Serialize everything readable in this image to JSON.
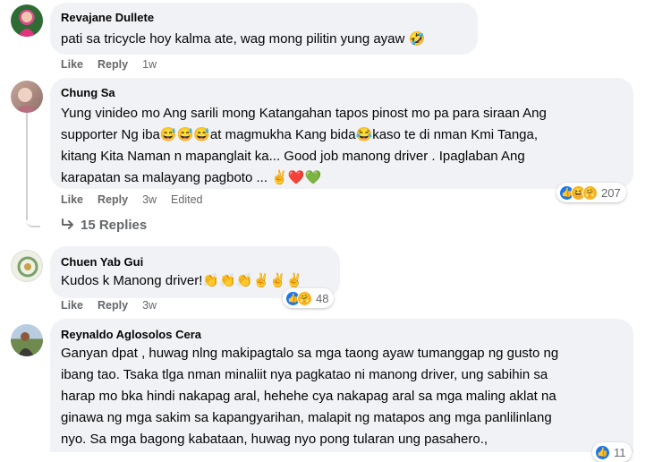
{
  "comments": [
    {
      "author": "Revajane Dullete",
      "text": "pati sa tricycle hoy kalma ate, wag mong pilitin yung ayaw 🤣",
      "like": "Like",
      "reply": "Reply",
      "time": "1w"
    },
    {
      "author": "Chung Sa",
      "line1": "Yung vinideo mo Ang sarili mong Katangahan tapos pinost mo pa para siraan Ang",
      "line2": "supporter Ng iba😅😅😅at magmukha Kang bida😂kaso te di nman Kmi Tanga,",
      "line3": "kitang Kita Naman n mapanglait ka... Good job manong driver . Ipaglaban Ang",
      "line4": "karapatan sa malayang pagboto ... ✌❤️💚",
      "like": "Like",
      "reply": "Reply",
      "time": "3w",
      "edited": "Edited",
      "reaction_count": "207",
      "replies_label": "15 Replies"
    },
    {
      "author": "Chuen Yab Gui",
      "text": "Kudos k Manong driver!👏👏👏✌✌✌",
      "like": "Like",
      "reply": "Reply",
      "time": "3w",
      "reaction_count": "48"
    },
    {
      "author": "Reynaldo Aglosolos Cera",
      "line1": "Ganyan dpat , huwag nlng makipagtalo sa mga taong ayaw tumanggap ng gusto ng",
      "line2": "ibang tao. Tsaka tlga nman minaliit nya pagkatao ni manong driver, ung sabihin sa",
      "line3": "harap mo bka hindi nakapag aral, hehehe cya nakapag aral sa mga maling aklat na",
      "line4": "ginawa ng mga sakim sa kapangyarihan, malapit ng matapos ang mga panlilinlang",
      "line5": "nyo. Sa mga bagong kabataan, huwag nyo pong tularan ung pasahero.,",
      "reaction_count": "11"
    }
  ]
}
